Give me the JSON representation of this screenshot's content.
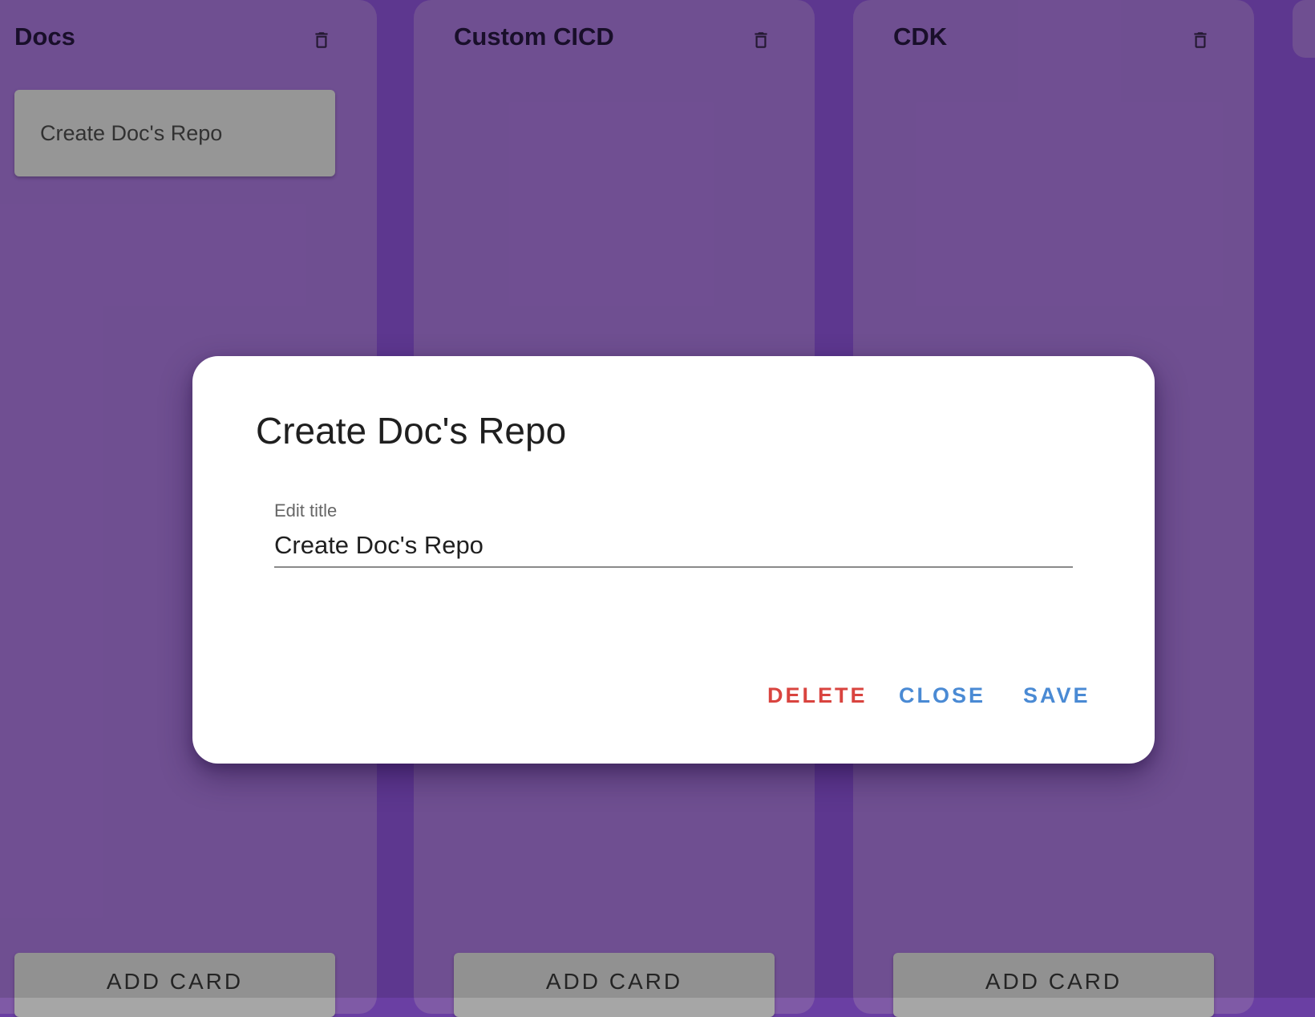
{
  "board": {
    "columns": [
      {
        "title": "Docs",
        "cards": [
          "Create Doc's Repo"
        ],
        "add_card_label": "ADD CARD"
      },
      {
        "title": "Custom CICD",
        "cards": [],
        "add_card_label": "ADD CARD"
      },
      {
        "title": "CDK",
        "cards": [],
        "add_card_label": "ADD CARD"
      }
    ]
  },
  "dialog": {
    "title": "Create Doc's Repo",
    "field_label": "Edit title",
    "field_value": "Create Doc's Repo",
    "delete_label": "DELETE",
    "close_label": "CLOSE",
    "save_label": "SAVE"
  },
  "colors": {
    "background": "#6a3fa3",
    "column": "#7f5aa6",
    "delete_button": "#d9443f",
    "action_button": "#4a8ad4"
  },
  "icons": {
    "column_action": "trash-icon"
  }
}
